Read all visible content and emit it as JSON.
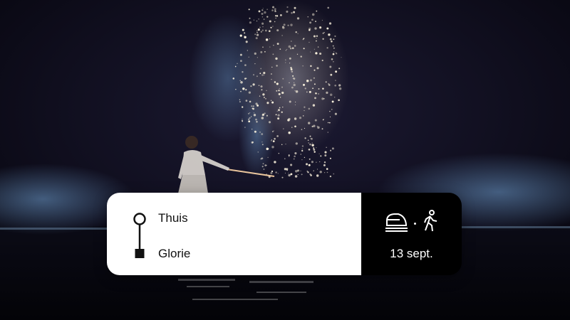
{
  "trip": {
    "origin": "Thuis",
    "destination": "Glorie",
    "date": "13 sept.",
    "modes": [
      "train-icon",
      "walking-person-icon"
    ]
  },
  "colors": {
    "card_left_bg": "#ffffff",
    "card_right_bg": "#000000",
    "background": "#0d0b1a"
  }
}
